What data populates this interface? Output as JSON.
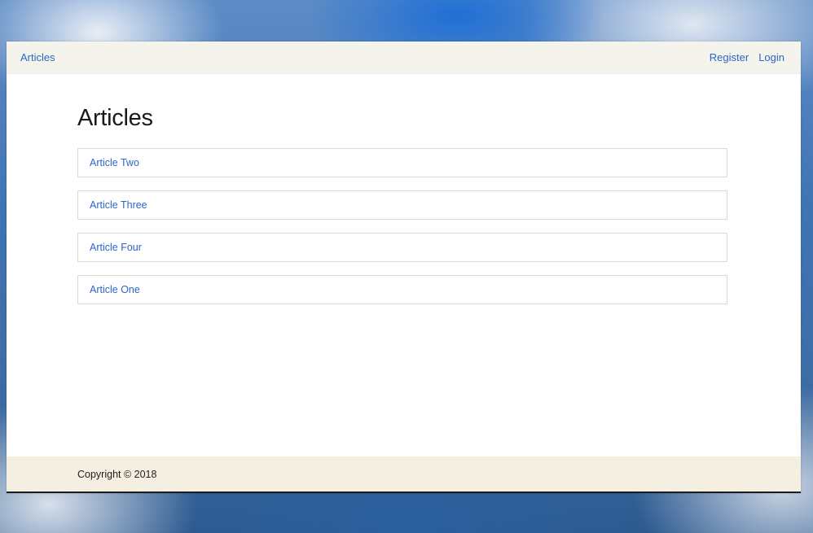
{
  "navbar": {
    "brand": "Articles",
    "links": [
      "Register",
      "Login"
    ]
  },
  "main": {
    "title": "Articles",
    "articles": [
      "Article Two",
      "Article Three",
      "Article Four",
      "Article One"
    ]
  },
  "footer": {
    "text": "Copyright © 2018"
  }
}
